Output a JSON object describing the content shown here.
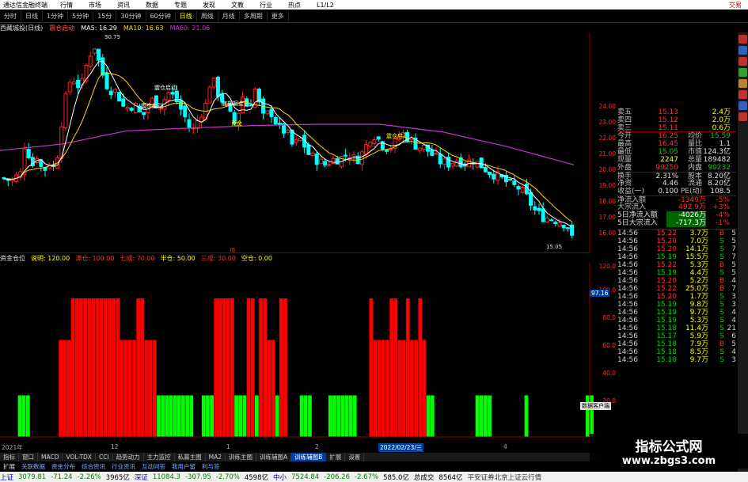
{
  "topbar": {
    "app_title": "通达信金融终端",
    "menus": [
      "行情",
      "市场",
      "资讯",
      "数据",
      "专题",
      "发现",
      "文教",
      "行业",
      "热点",
      "L1/L2"
    ],
    "right_label": "交易"
  },
  "toolbar": {
    "items": [
      "分时",
      "日线",
      "1分钟",
      "5分钟",
      "15分",
      "30分钟",
      "60分钟",
      "日线",
      "周线",
      "月线",
      "多周期",
      "更多"
    ]
  },
  "infobar": {
    "stock": "西藏城投(日线)",
    "signal": "震仓启动",
    "ma5": "MA5: 16.29",
    "ma10": "MA10: 16.63",
    "ma60": "MA60: 21.06"
  },
  "annotations": {
    "high": "30.75",
    "low": "15.05",
    "label1": "震仓启动",
    "label2": "震仓启动",
    "label3": "黄金",
    "label4": "底部掘金日",
    "label5": "震仓启动",
    "marker": "顶"
  },
  "subinfo": {
    "title": "资金仓位",
    "desc": "说明: 120.00",
    "full": "满仓: 100.00",
    "seven": "七成: 70.00",
    "half": "半仓: 50.00",
    "three": "三成: 30.00",
    "empty": "空仓: 0.00"
  },
  "price_axis": [
    "24.00",
    "23.00",
    "22.00",
    "21.00",
    "20.00",
    "19.00",
    "18.00",
    "17.00",
    "16.00"
  ],
  "sub_axis": [
    "120.0",
    "100.0",
    "80.0",
    "60.0",
    "40.0",
    "20.0"
  ],
  "sub_marker": "97.16",
  "dates": {
    "d1": "2021年",
    "d2": "12",
    "d3": "1",
    "d4": "2",
    "d5": "2022/02/23/三",
    "d6": "4"
  },
  "quote": {
    "sell5": {
      "label": "卖五",
      "price": "15.13",
      "vol": "2.4万"
    },
    "sell4": {
      "label": "卖四",
      "price": "15.12",
      "vol": "2.0万"
    },
    "sell3": {
      "label": "卖三",
      "price": "15.11",
      "vol": "0.6万"
    },
    "rows": [
      {
        "l": "今开",
        "v": "16.25",
        "l2": "均价",
        "v2": "15.59"
      },
      {
        "l": "最高",
        "v": "16.45",
        "l2": "量比",
        "v2": "1.1"
      },
      {
        "l": "最低",
        "v": "15.05",
        "l2": "市值",
        "v2": "124.3亿"
      },
      {
        "l": "现量",
        "v": "2247",
        "l2": "总量",
        "v2": "189482"
      },
      {
        "l": "外盘",
        "v": "99250",
        "l2": "内盘",
        "v2": "90232"
      },
      {
        "l": "换手",
        "v": "2.31%",
        "l2": "股本",
        "v2": "8.20亿"
      },
      {
        "l": "净资",
        "v": "4.46",
        "l2": "流通",
        "v2": "8.20亿"
      },
      {
        "l": "收益(一)",
        "v": "0.100",
        "l2": "PE(动)",
        "v2": "108.5"
      }
    ],
    "flows": [
      {
        "l": "净流入额",
        "v": "-1349万",
        "p": "-5%"
      },
      {
        "l": "大宗流入",
        "v": "492.9万",
        "p": "+3%"
      },
      {
        "l": "5日净流入额",
        "v": "-4026万",
        "p": "-4%"
      },
      {
        "l": "5日大宗流入",
        "v": "-717.3万",
        "p": "-1%"
      }
    ]
  },
  "ticks": [
    {
      "t": "14:56",
      "p": "15.22",
      "v": "3.7万",
      "bs": "B",
      "n": "5"
    },
    {
      "t": "14:56",
      "p": "15.20",
      "v": "7.0万",
      "bs": "S",
      "n": "5"
    },
    {
      "t": "14:56",
      "p": "15.20",
      "v": "14.1万",
      "bs": "S",
      "n": "7"
    },
    {
      "t": "14:56",
      "p": "15.19",
      "v": "15.5万",
      "bs": "S",
      "n": "7"
    },
    {
      "t": "14:56",
      "p": "15.22",
      "v": "5.3万",
      "bs": "B",
      "n": "5"
    },
    {
      "t": "14:56",
      "p": "15.19",
      "v": "4.4万",
      "bs": "S",
      "n": "5"
    },
    {
      "t": "14:56",
      "p": "15.20",
      "v": "5.2万",
      "bs": "B",
      "n": "4"
    },
    {
      "t": "14:56",
      "p": "15.22",
      "v": "25.0万",
      "bs": "B",
      "n": "7"
    },
    {
      "t": "14:56",
      "p": "15.20",
      "v": "1.7万",
      "bs": "S",
      "n": "3"
    },
    {
      "t": "14:56",
      "p": "15.19",
      "v": "9.8万",
      "bs": "S",
      "n": "3"
    },
    {
      "t": "14:56",
      "p": "15.19",
      "v": "9.7万",
      "bs": "S",
      "n": "4"
    },
    {
      "t": "14:56",
      "p": "15.19",
      "v": "5.3万",
      "bs": "S",
      "n": "4"
    },
    {
      "t": "14:56",
      "p": "15.18",
      "v": "11.4万",
      "bs": "S",
      "n": "21"
    },
    {
      "t": "14:56",
      "p": "15.17",
      "v": "5.9万",
      "bs": "S",
      "n": "6"
    },
    {
      "t": "14:56",
      "p": "15.18",
      "v": "7.9万",
      "bs": "B",
      "n": "5"
    },
    {
      "t": "14:56",
      "p": "15.18",
      "v": "8.5万",
      "bs": "S",
      "n": "4"
    },
    {
      "t": "14:56",
      "p": "15.18",
      "v": "9.7万",
      "bs": "S",
      "n": "3"
    }
  ],
  "tabs": [
    "指标",
    "窗口",
    "MACD",
    "VOL-TDX",
    "CCI",
    "趋势动力",
    "主力监控",
    "私募主图",
    "MA2",
    "训练主图",
    "训练辅图A",
    "训练辅图B",
    "扩展",
    "设置"
  ],
  "tabs2_tag": "扩展",
  "tabs2": [
    "关联数据",
    "资金分布",
    "综合资讯",
    "行业资讯",
    "互动问答",
    "我用户留",
    "利与答"
  ],
  "status": {
    "sh_label": "上证",
    "sh": "3079.81",
    "sh_chg": "-71.24",
    "sh_pct": "-2.26%",
    "sh_amt": "3965亿",
    "sz_label": "深证",
    "sz": "11084.3",
    "sz_chg": "-307.95",
    "sz_pct": "-2.70%",
    "sz_amt": "4598亿",
    "zx_label": "中小",
    "zx": "7524.84",
    "zx_chg": "-206.26",
    "zx_pct": "-2.67%",
    "zx_amt": "585.0亿",
    "total_label": "总成交",
    "total": "8564亿",
    "broker": "平安证券北京上证云行情"
  },
  "watermark": {
    "title": "指标公式网",
    "url": "www.zbgs3.com"
  },
  "tooltip": "数据客户端",
  "colors": {
    "up": "#ff2020",
    "down": "#00ffff",
    "green": "#00ff00",
    "red": "#ff0000",
    "ma5": "#ffffff",
    "ma10": "#ffd700",
    "ma60": "#cc33cc"
  },
  "chart_data": {
    "type": "bar",
    "title": "资金仓位",
    "ylim": [
      0,
      120
    ],
    "levels": {
      "full": 100,
      "seven": 70,
      "half": 50,
      "three": 30,
      "empty": 0
    },
    "series": [
      {
        "color": "red",
        "values": [
          0,
          0,
          0,
          0,
          0,
          0,
          0,
          0,
          0,
          0,
          0,
          0,
          0,
          0,
          70,
          70,
          70,
          100,
          100,
          100,
          100,
          100,
          100,
          100,
          100,
          100,
          100,
          100,
          100,
          70,
          70,
          70,
          70,
          100,
          100,
          70,
          70,
          70,
          0,
          0,
          0,
          0,
          0,
          0,
          0,
          0,
          0,
          0,
          0,
          0,
          0,
          0,
          100,
          100,
          100,
          100,
          100,
          0,
          0,
          0,
          100,
          100,
          0,
          100,
          100,
          70,
          70,
          0,
          100,
          100,
          0,
          0,
          0,
          0,
          0,
          0,
          0,
          0,
          0,
          0,
          0,
          0,
          0,
          0,
          0,
          0,
          0,
          0,
          0,
          0,
          100,
          70,
          70,
          70,
          70,
          100,
          100,
          70,
          70,
          100,
          70,
          70,
          100,
          70,
          0,
          0,
          0,
          0,
          0,
          0,
          0,
          0,
          0,
          0,
          0,
          0,
          0,
          0,
          0,
          0,
          0,
          0,
          0,
          0,
          0,
          0,
          0,
          0,
          0,
          0,
          0,
          0,
          0,
          0,
          0,
          0,
          0,
          0,
          0,
          0,
          0,
          0,
          0
        ]
      },
      {
        "color": "green",
        "values": [
          0,
          0,
          0,
          0,
          30,
          30,
          30,
          0,
          0,
          0,
          0,
          0,
          0,
          0,
          0,
          0,
          0,
          0,
          0,
          0,
          0,
          0,
          0,
          0,
          0,
          0,
          0,
          0,
          0,
          0,
          0,
          0,
          0,
          0,
          0,
          0,
          0,
          0,
          30,
          30,
          30,
          30,
          30,
          30,
          30,
          30,
          30,
          0,
          0,
          30,
          30,
          30,
          0,
          0,
          0,
          0,
          0,
          30,
          30,
          30,
          0,
          0,
          30,
          0,
          0,
          0,
          0,
          30,
          0,
          0,
          0,
          0,
          0,
          30,
          30,
          30,
          0,
          0,
          0,
          0,
          30,
          30,
          30,
          30,
          30,
          30,
          30,
          0,
          0,
          0,
          0,
          0,
          0,
          0,
          0,
          0,
          0,
          0,
          0,
          0,
          0,
          0,
          0,
          0,
          30,
          30,
          0,
          0,
          0,
          0,
          0,
          0,
          0,
          0,
          0,
          0,
          30,
          30,
          30,
          30,
          0,
          0,
          0,
          0,
          0,
          0,
          0,
          0,
          30,
          0,
          0,
          0,
          0,
          0,
          0,
          0,
          0,
          0,
          0,
          0,
          0,
          0,
          0,
          30,
          30,
          0
        ]
      }
    ]
  }
}
